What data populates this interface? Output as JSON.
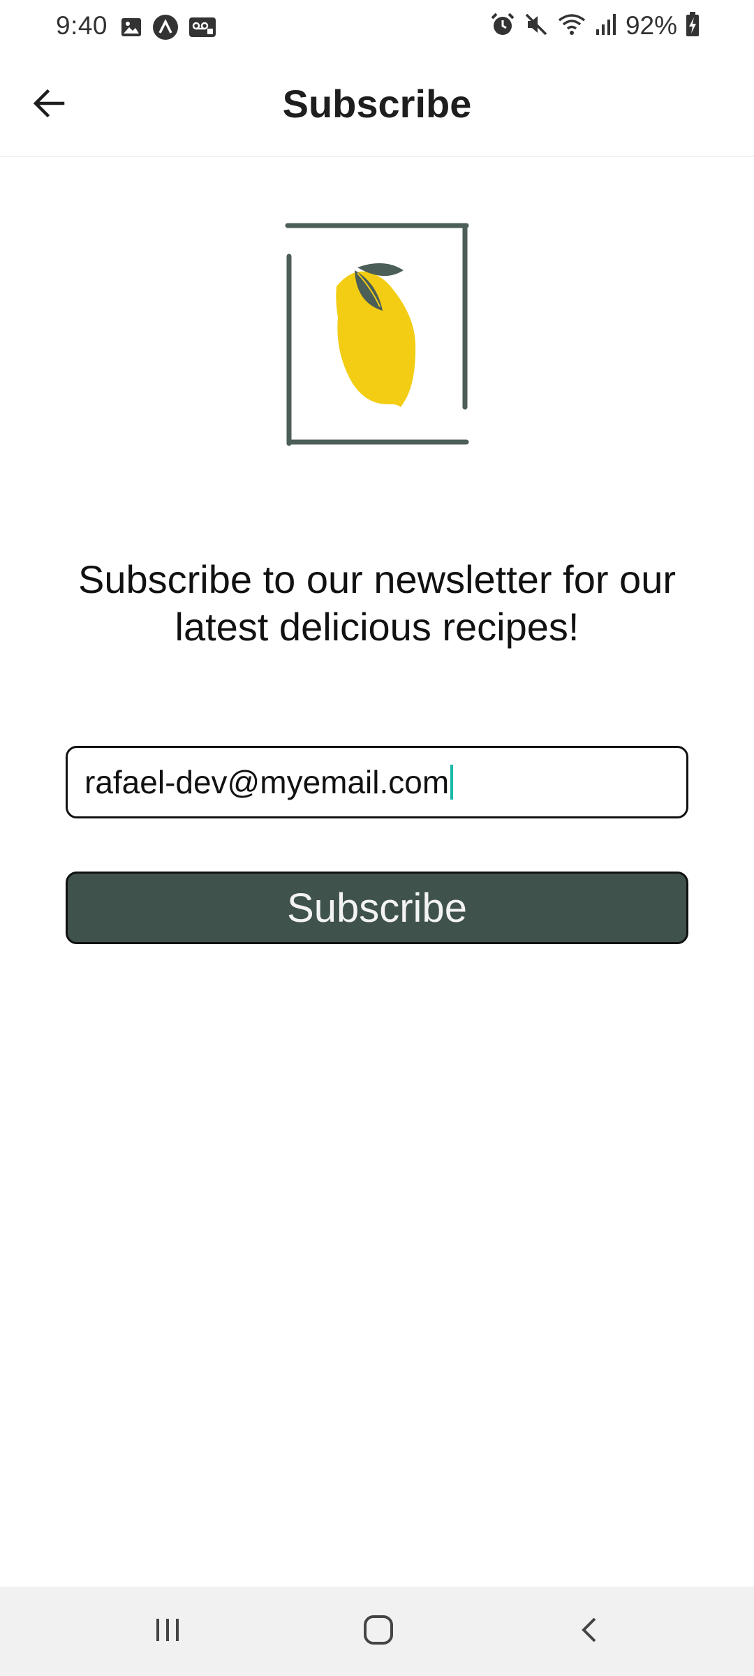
{
  "status_bar": {
    "time": "9:40",
    "battery": "92%",
    "left_icons": [
      "image-icon",
      "app-icon",
      "voicemail-icon"
    ],
    "right_icons": [
      "alarm-icon",
      "mute-icon",
      "wifi-icon",
      "signal-icon",
      "battery-charging-icon"
    ]
  },
  "app_bar": {
    "title": "Subscribe",
    "back_icon": "arrow-left-icon"
  },
  "logo": {
    "icon": "lemon-icon",
    "colors": {
      "frame": "#4b5e57",
      "lemon": "#f2cd14",
      "leaf": "#4b5e57"
    }
  },
  "main": {
    "headline_line1": "Subscribe to our newsletter for our",
    "headline_line2": "latest delicious recipes!",
    "email_value": "rafael-dev@myemail.com",
    "subscribe_label": "Subscribe"
  },
  "colors": {
    "button_bg": "#3f524b",
    "button_text": "#f3f3f3",
    "caret": "#19b9a9",
    "nav_bg": "#f1f1f1"
  },
  "nav": {
    "icons": [
      "recent-apps-icon",
      "home-icon",
      "back-icon"
    ]
  }
}
